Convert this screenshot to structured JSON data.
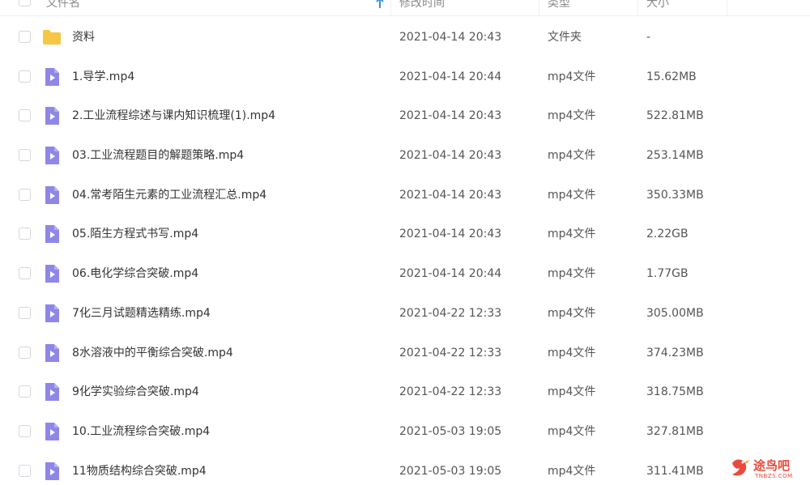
{
  "header": {
    "col_name": "文件名",
    "col_modified": "修改时间",
    "col_type": "类型",
    "col_size": "大小",
    "sort_icon": "sort-arrow-icon"
  },
  "files": [
    {
      "name": "资料",
      "modified": "2021-04-14 20:43",
      "type": "文件夹",
      "size": "-",
      "icon": "folder-icon"
    },
    {
      "name": "1.导学.mp4",
      "modified": "2021-04-14 20:44",
      "type": "mp4文件",
      "size": "15.62MB",
      "icon": "video-file-icon"
    },
    {
      "name": "2.工业流程综述与课内知识梳理(1).mp4",
      "modified": "2021-04-14 20:43",
      "type": "mp4文件",
      "size": "522.81MB",
      "icon": "video-file-icon"
    },
    {
      "name": "03.工业流程题目的解题策略.mp4",
      "modified": "2021-04-14 20:43",
      "type": "mp4文件",
      "size": "253.14MB",
      "icon": "video-file-icon"
    },
    {
      "name": "04.常考陌生元素的工业流程汇总.mp4",
      "modified": "2021-04-14 20:43",
      "type": "mp4文件",
      "size": "350.33MB",
      "icon": "video-file-icon"
    },
    {
      "name": "05.陌生方程式书写.mp4",
      "modified": "2021-04-14 20:43",
      "type": "mp4文件",
      "size": "2.22GB",
      "icon": "video-file-icon"
    },
    {
      "name": "06.电化学综合突破.mp4",
      "modified": "2021-04-14 20:44",
      "type": "mp4文件",
      "size": "1.77GB",
      "icon": "video-file-icon"
    },
    {
      "name": "7化三月试题精选精练.mp4",
      "modified": "2021-04-22 12:33",
      "type": "mp4文件",
      "size": "305.00MB",
      "icon": "video-file-icon"
    },
    {
      "name": "8水溶液中的平衡综合突破.mp4",
      "modified": "2021-04-22 12:33",
      "type": "mp4文件",
      "size": "374.23MB",
      "icon": "video-file-icon"
    },
    {
      "name": "9化学实验综合突破.mp4",
      "modified": "2021-04-22 12:33",
      "type": "mp4文件",
      "size": "318.75MB",
      "icon": "video-file-icon"
    },
    {
      "name": "10.工业流程综合突破.mp4",
      "modified": "2021-05-03 19:05",
      "type": "mp4文件",
      "size": "327.81MB",
      "icon": "video-file-icon"
    },
    {
      "name": "11物质结构综合突破.mp4",
      "modified": "2021-05-03 19:05",
      "type": "mp4文件",
      "size": "311.41MB",
      "icon": "video-file-icon"
    }
  ],
  "watermark": {
    "text": "途鸟吧",
    "sub": "TNBZS.COM",
    "icon": "bird-logo-icon"
  },
  "colors": {
    "folder": "#f7c645",
    "video_icon": "#8e87e8",
    "sort_arrow": "#3a8ee6",
    "watermark": "#e94b3c"
  }
}
